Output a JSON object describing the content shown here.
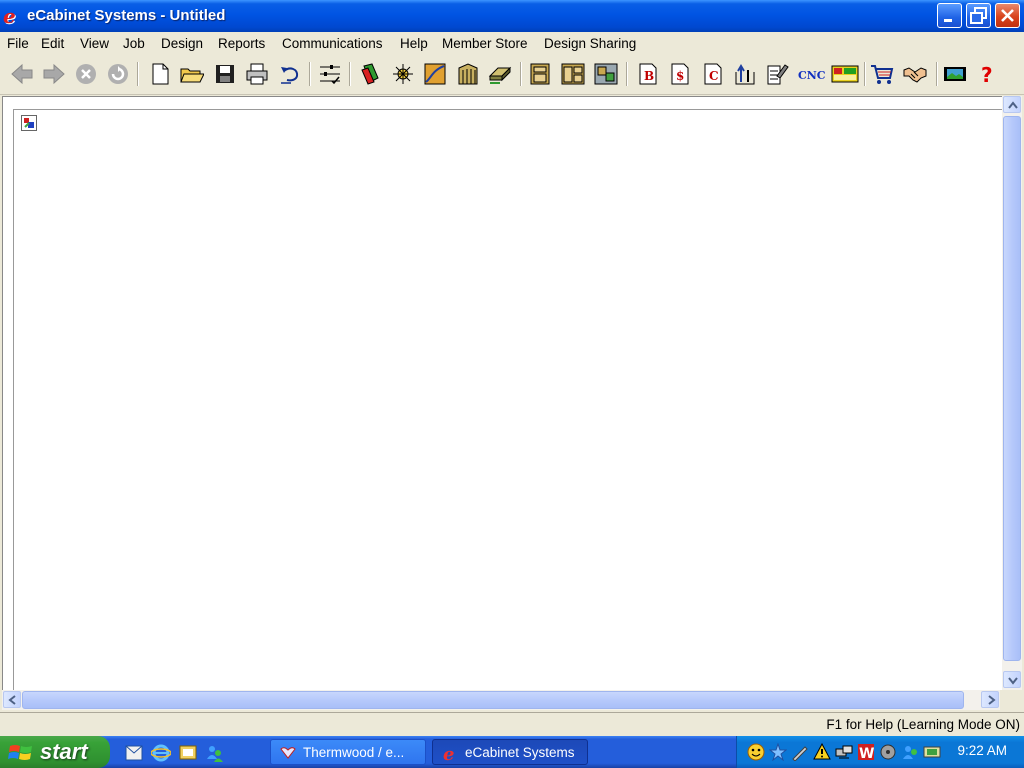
{
  "window": {
    "title": "eCabinet Systems - Untitled",
    "app_icon": "ecabinet-logo-icon",
    "app_icon_glyph": "e"
  },
  "menu": [
    {
      "label": "File"
    },
    {
      "label": "Edit"
    },
    {
      "label": "View"
    },
    {
      "label": "Job"
    },
    {
      "label": "Design"
    },
    {
      "label": "Reports"
    },
    {
      "label": "Communications"
    },
    {
      "label": "Help"
    },
    {
      "label": "Member Store"
    },
    {
      "label": "Design Sharing"
    }
  ],
  "toolbar": {
    "buttons": [
      "back-arrow-icon",
      "forward-arrow-icon",
      "stop-icon",
      "refresh-icon",
      "new-document-icon",
      "open-folder-icon",
      "save-disk-icon",
      "print-icon",
      "undo-icon",
      "settings-icon",
      "material-icon",
      "hardware-icon",
      "profile-icon",
      "door-icon",
      "panel-icon",
      "cabinet-icon",
      "cabinet-layout-icon",
      "room-icon",
      "bill-icon",
      "cost-icon",
      "cutlist-icon",
      "export-icon",
      "edit-report-icon",
      "cnc-icon",
      "nest-icon",
      "shopping-cart-icon",
      "handshake-icon",
      "video-icon",
      "help-question-icon"
    ],
    "labels": {
      "bill": "B",
      "cost": "$",
      "cutlist": "C",
      "cnc": "CNC",
      "help": "?"
    }
  },
  "status": {
    "text": "F1 for Help (Learning Mode ON)"
  },
  "taskbar": {
    "start_label": "start",
    "tasks": [
      {
        "label": "Thermwood / e...",
        "active": false
      },
      {
        "label": "eCabinet Systems",
        "active": true
      }
    ],
    "clock": "9:22 AM"
  },
  "colors": {
    "titlebar": "#0054e3",
    "taskbar": "#245edb",
    "start_green": "#38a238",
    "face": "#ece9d8"
  }
}
